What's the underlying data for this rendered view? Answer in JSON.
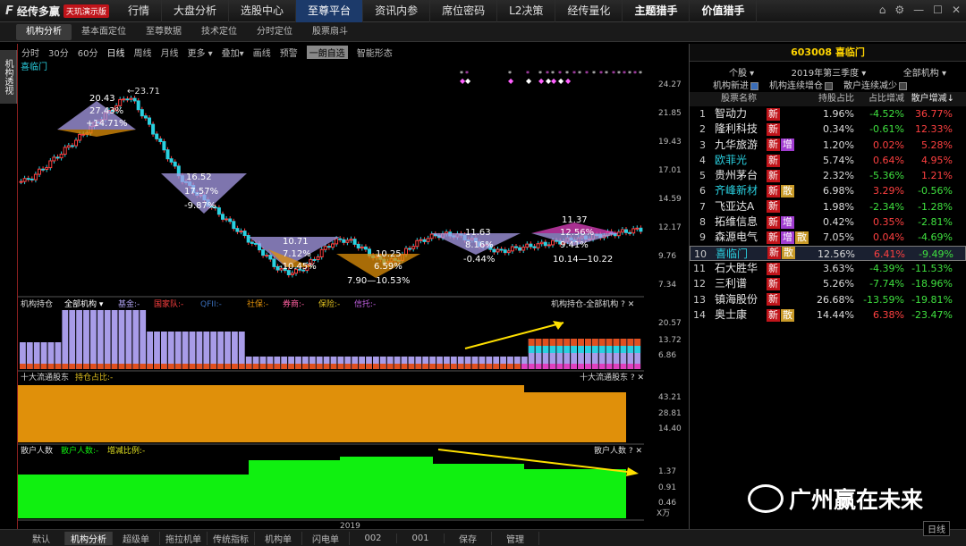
{
  "app": {
    "mark": "F",
    "name": "经传多赢",
    "badge": "天玑演示版"
  },
  "nav": [
    {
      "label": "行情"
    },
    {
      "label": "大盘分析"
    },
    {
      "label": "选股中心"
    },
    {
      "label": "至尊平台",
      "active": true
    },
    {
      "label": "资讯内参"
    },
    {
      "label": "席位密码"
    },
    {
      "label": "L2决策"
    },
    {
      "label": "经传量化"
    },
    {
      "label": "主题猎手",
      "bold": true
    },
    {
      "label": "价值猎手",
      "bold": true
    }
  ],
  "window_controls": [
    "⌂",
    "⚙",
    "—",
    "☐",
    "✕"
  ],
  "subtabs": [
    {
      "label": "机构分析",
      "active": true
    },
    {
      "label": "基本面定位"
    },
    {
      "label": "至尊数据"
    },
    {
      "label": "技术定位"
    },
    {
      "label": "分时定位"
    },
    {
      "label": "股票扇斗"
    }
  ],
  "vtab": "机构透视",
  "toolbar": {
    "items": [
      "分时",
      "30分",
      "60分",
      "日线",
      "周线",
      "月线",
      "更多 ▾",
      "叠加▾",
      "画线",
      "预警"
    ],
    "select": "一朗自选",
    "extra": "智能形态"
  },
  "stock_label": "喜临门",
  "price_axis": [
    "24.27",
    "21.85",
    "19.43",
    "17.01",
    "14.59",
    "12.17",
    "9.76",
    "7.34"
  ],
  "annotations": {
    "peak": "23.71",
    "tri1": [
      "20.43",
      "27.43%",
      "+14.71%"
    ],
    "tri2": [
      "16.52",
      "17.57%",
      "-9.87%"
    ],
    "tri3": [
      "10.71",
      "7.12%",
      "-10.45%"
    ],
    "tri4": [
      "10.25",
      "6.59%",
      "7.90—10.53%"
    ],
    "tri5": [
      "11.63",
      "8.16%",
      "-0.44%"
    ],
    "tri6": [
      "11.37",
      "12.56%",
      "9.41%",
      "10.14—10.22"
    ]
  },
  "panel1": {
    "title": "机构持仓",
    "select": "全部机构",
    "legend": [
      "基金",
      "国家队",
      "QFII",
      "社保",
      "券商",
      "保险",
      "信托"
    ],
    "right_title": "机构持仓-全部机构",
    "axis": [
      "20.57",
      "13.72",
      "6.86"
    ]
  },
  "panel2": {
    "title": "十大流通股东",
    "legend": "持仓占比:-",
    "right_title": "十大流通股东",
    "axis": [
      "43.21",
      "28.81",
      "14.40"
    ]
  },
  "panel3": {
    "title": "散户人数",
    "legend1": "散户人数:-",
    "legend2": "增减比例:-",
    "right_title": "散户人数",
    "axis": [
      "1.37",
      "0.91",
      "0.46"
    ],
    "unit": "X万"
  },
  "year_label": "2019",
  "right": {
    "code": "603008",
    "name": "喜临门",
    "filters": [
      "个股 ▾",
      "2019年第三季度 ▾",
      "全部机构 ▾"
    ],
    "checks": [
      {
        "label": "机构新进",
        "on": true
      },
      {
        "label": "机构连续增仓",
        "on": false
      },
      {
        "label": "散户连续减少",
        "on": false
      }
    ],
    "headers": [
      "股票名称",
      "持股占比",
      "占比增减",
      "散户增减↓"
    ],
    "rows": [
      {
        "no": "1",
        "name": "智动力",
        "tags": [
          "新"
        ],
        "p": "1.96%",
        "ch": "-4.52%",
        "hh": "36.77%"
      },
      {
        "no": "2",
        "name": "隆利科技",
        "tags": [
          "新"
        ],
        "p": "0.34%",
        "ch": "-0.61%",
        "hh": "12.33%"
      },
      {
        "no": "3",
        "name": "九华旅游",
        "tags": [
          "新",
          "增"
        ],
        "p": "1.20%",
        "ch": "0.02%",
        "hh": "5.28%"
      },
      {
        "no": "4",
        "name": "欧菲光",
        "tags": [
          "新"
        ],
        "p": "5.74%",
        "ch": "0.64%",
        "hh": "4.95%"
      },
      {
        "no": "5",
        "name": "贵州茅台",
        "tags": [
          "新"
        ],
        "p": "2.32%",
        "ch": "-5.36%",
        "hh": "1.21%"
      },
      {
        "no": "6",
        "name": "齐峰新材",
        "tags": [
          "新",
          "散"
        ],
        "p": "6.98%",
        "ch": "3.29%",
        "hh": "-0.56%"
      },
      {
        "no": "7",
        "name": "飞亚达A",
        "tags": [
          "新"
        ],
        "p": "1.98%",
        "ch": "-2.34%",
        "hh": "-1.28%"
      },
      {
        "no": "8",
        "name": "拓维信息",
        "tags": [
          "新",
          "增"
        ],
        "p": "0.42%",
        "ch": "0.35%",
        "hh": "-2.81%"
      },
      {
        "no": "9",
        "name": "森源电气",
        "tags": [
          "新",
          "增",
          "散"
        ],
        "p": "7.05%",
        "ch": "0.04%",
        "hh": "-4.69%"
      },
      {
        "no": "10",
        "name": "喜临门",
        "tags": [
          "新",
          "散"
        ],
        "p": "12.56%",
        "ch": "6.41%",
        "hh": "-9.49%",
        "sel": true
      },
      {
        "no": "11",
        "name": "石大胜华",
        "tags": [
          "新"
        ],
        "p": "3.63%",
        "ch": "-4.39%",
        "hh": "-11.53%"
      },
      {
        "no": "12",
        "name": "三利谱",
        "tags": [
          "新"
        ],
        "p": "5.26%",
        "ch": "-7.74%",
        "hh": "-18.96%"
      },
      {
        "no": "13",
        "name": "镇海股份",
        "tags": [
          "新"
        ],
        "p": "26.68%",
        "ch": "-13.59%",
        "hh": "-19.81%"
      },
      {
        "no": "14",
        "name": "奥士康",
        "tags": [
          "新",
          "散"
        ],
        "p": "14.44%",
        "ch": "6.38%",
        "hh": "-23.47%"
      }
    ]
  },
  "bottom_tabs": [
    {
      "label": "默认"
    },
    {
      "label": "机构分析",
      "active": true
    },
    {
      "label": "超级单"
    },
    {
      "label": "拖拉机单"
    },
    {
      "label": "传统指标"
    },
    {
      "label": "机构单"
    },
    {
      "label": "闪电单"
    },
    {
      "label": "002"
    },
    {
      "label": "001"
    },
    {
      "label": "保存"
    },
    {
      "label": "管理"
    }
  ],
  "bottom_right": "日线",
  "watermark": "广州赢在未来",
  "colors": {
    "accent": "#1c3a6a",
    "up": "#ff4040",
    "down": "#3fe03f",
    "inst": "#a89ce8",
    "orange": "#e0900a",
    "green": "#10f010",
    "cyan": "#2ad0e0",
    "magenta": "#e040c0"
  }
}
